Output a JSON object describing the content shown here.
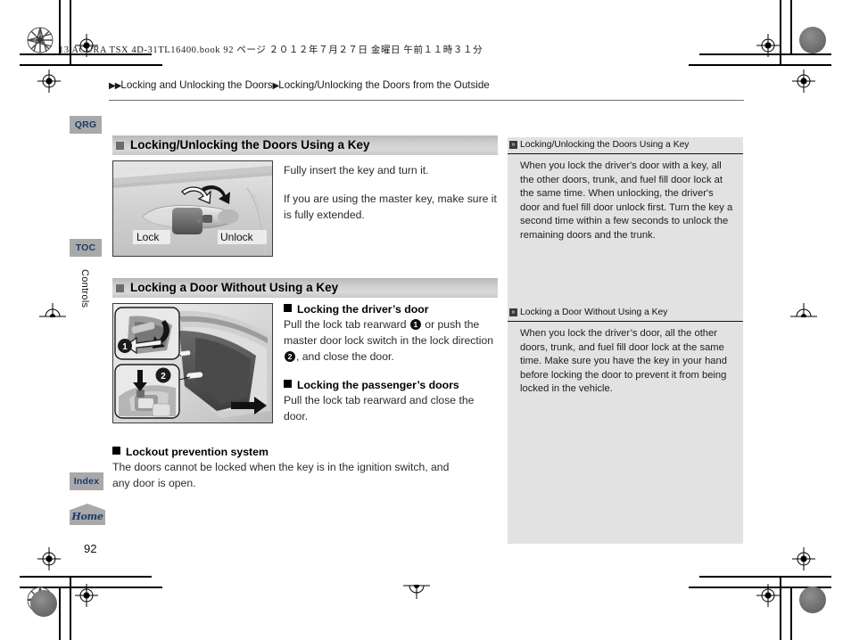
{
  "document": {
    "meta_line": "13 ACURA TSX 4D-31TL16400.book   92 ページ   ２０１２年７月２７日   金曜日   午前１１時３１分",
    "page_number": "92",
    "side_label": "Controls"
  },
  "breadcrumb": {
    "arrow1": "▶▶",
    "item1": "Locking and Unlocking the Doors",
    "arrow2": "▶",
    "item2": "Locking/Unlocking the Doors from the Outside"
  },
  "rail": {
    "qrg": "QRG",
    "toc": "TOC",
    "index": "Index",
    "home": "Home"
  },
  "sections": [
    {
      "title": "Locking/Unlocking the Doors Using a Key",
      "figure": {
        "name": "door-handle-key-illustration",
        "label_left": "Lock",
        "label_right": "Unlock"
      },
      "paragraphs": [
        "Fully insert the key and turn it.",
        "If you are using the master key, make sure it is fully extended."
      ]
    },
    {
      "title": "Locking a Door Without Using a Key",
      "figure": {
        "name": "door-lock-tab-illustration",
        "callout1": "1",
        "callout2": "2"
      },
      "subsections": [
        {
          "heading": "Locking the driver’s door",
          "text_before_1": "Pull the lock tab rearward ",
          "num1": "1",
          "text_between": " or push the master door lock switch in the lock direction ",
          "num2": "2",
          "text_after": ", and close the door."
        },
        {
          "heading": "Locking the passenger’s doors",
          "body": "Pull the lock tab rearward and close the door."
        }
      ]
    },
    {
      "heading": "Lockout prevention system",
      "body": "The doors cannot be locked when the key is in the ignition switch, and any door is open."
    }
  ],
  "notes": [
    {
      "title": "Locking/Unlocking the Doors Using a Key",
      "body": "When you lock the driver's door with a key, all the other doors, trunk, and fuel fill door lock at the same time. When unlocking, the driver's door and fuel fill door unlock first. Turn the key a second time within a few seconds to unlock the remaining doors and the trunk."
    },
    {
      "title": "Locking a Door Without Using a Key",
      "body": "When you lock the driver’s door, all the other doors, trunk, and fuel fill door lock at the same time. Make sure you have the key in your hand before locking the door to prevent it from being locked in the vehicle."
    }
  ],
  "colors": {
    "tab_bg": "#a9a9a9",
    "tab_text": "#1b3a6b",
    "section_head_bg": "#cfcfcf",
    "notes_bg": "#e2e2e2"
  }
}
